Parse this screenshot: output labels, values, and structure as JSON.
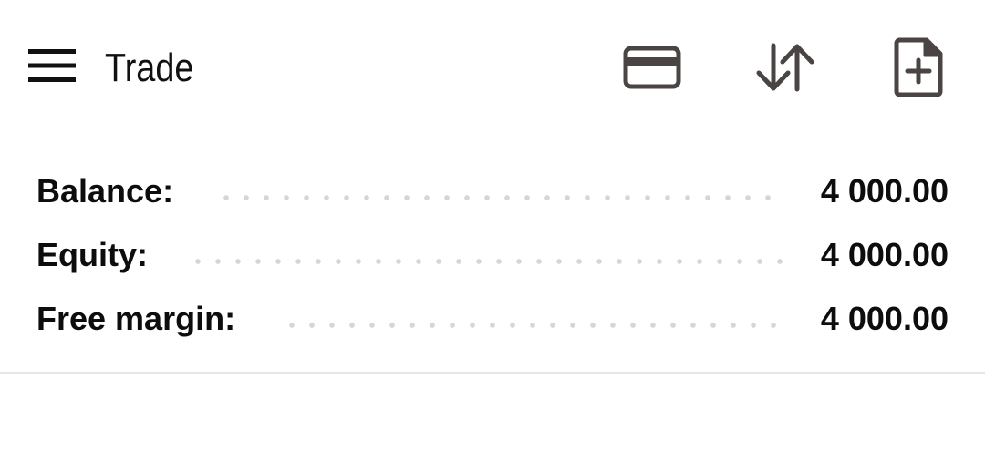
{
  "header": {
    "title": "Trade",
    "menu_icon": "hamburger-menu-icon",
    "actions": [
      {
        "icon": "credit-card-icon"
      },
      {
        "icon": "sort-arrows-icon"
      },
      {
        "icon": "new-order-file-icon"
      }
    ]
  },
  "account": {
    "balance_label": "Balance:",
    "balance_value": "4 000.00",
    "equity_label": "Equity:",
    "equity_value": "4 000.00",
    "free_margin_label": "Free margin:",
    "free_margin_value": "4 000.00"
  },
  "colors": {
    "icon": "#4a4443",
    "text": "#0d0d0d",
    "dots": "#d6d6d6",
    "divider": "#e6e6e6"
  }
}
